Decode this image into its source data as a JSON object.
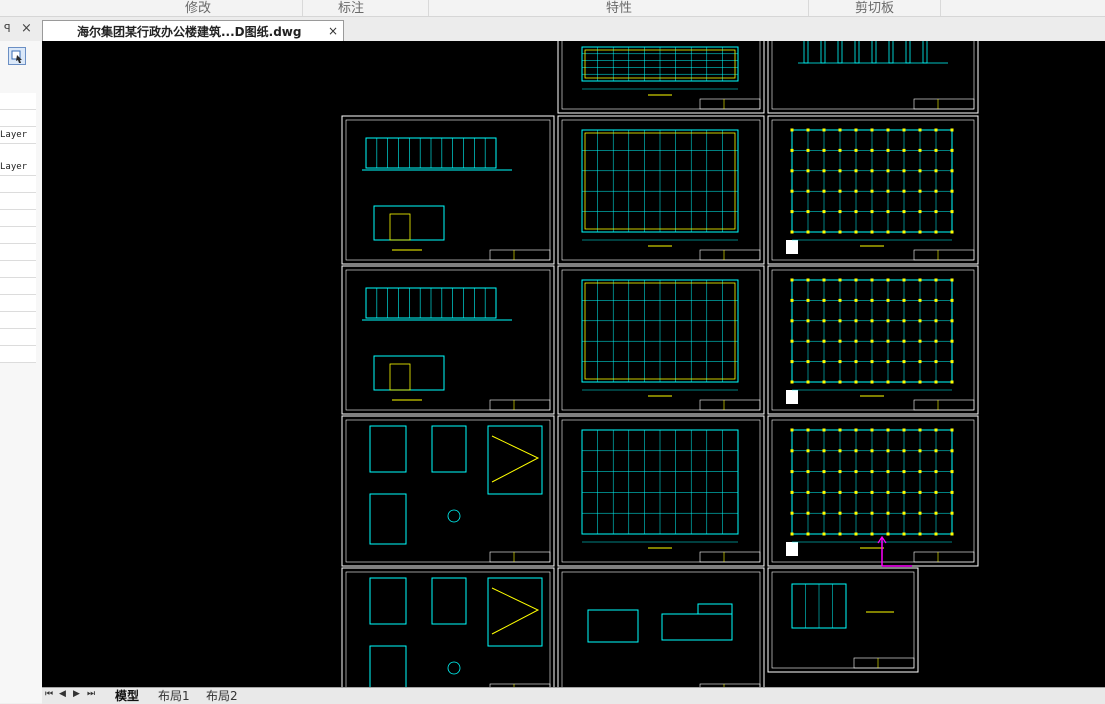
{
  "ribbon": {
    "groups": [
      "修改",
      "标注",
      "特性",
      "剪切板"
    ]
  },
  "tabs": {
    "document_title": "海尔集团某行政办公楼建筑...D图纸.dwg",
    "close_glyph": "×"
  },
  "left_panel": {
    "pin_glyph": "ꟼ",
    "close_glyph": "×",
    "layer_rows": [
      "Layer",
      "Layer"
    ]
  },
  "layout_tabs": {
    "nav": [
      "⏮",
      "◀",
      "▶",
      "⏭"
    ],
    "items": [
      "模型",
      "布局1",
      "布局2"
    ],
    "active": "模型"
  },
  "colors": {
    "canvas_bg": "#000000",
    "sheet_border": "#ffffff",
    "line_cyan": "#00ffff",
    "line_yellow": "#ffff00",
    "ucs_magenta": "#ff00ff"
  }
}
